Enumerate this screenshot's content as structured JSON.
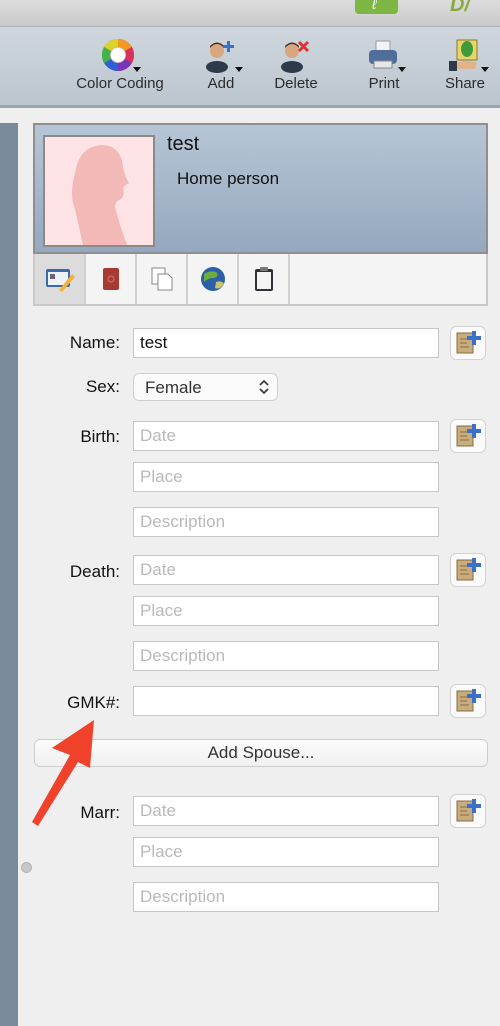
{
  "toolbar": {
    "items": [
      {
        "label": "Color Coding",
        "icon": "color-wheel-icon",
        "has_dropdown": true
      },
      {
        "label": "Add",
        "icon": "add-person-icon",
        "has_dropdown": true
      },
      {
        "label": "Delete",
        "icon": "delete-person-icon",
        "has_dropdown": false
      },
      {
        "label": "Print",
        "icon": "printer-icon",
        "has_dropdown": true
      },
      {
        "label": "Share",
        "icon": "share-tree-icon",
        "has_dropdown": true
      }
    ]
  },
  "person_card": {
    "name": "test",
    "subtitle": "Home person",
    "photo_placeholder": "female-silhouette-icon"
  },
  "tabs": [
    {
      "icon": "edit-person-icon",
      "active": true
    },
    {
      "icon": "book-icon",
      "active": false
    },
    {
      "icon": "documents-icon",
      "active": false
    },
    {
      "icon": "globe-icon",
      "active": false
    },
    {
      "icon": "clipboard-icon",
      "active": false
    }
  ],
  "form": {
    "name": {
      "label": "Name:",
      "value": "test"
    },
    "sex": {
      "label": "Sex:",
      "value": "Female"
    },
    "birth": {
      "label": "Birth:",
      "date_placeholder": "Date",
      "place_placeholder": "Place",
      "description_placeholder": "Description"
    },
    "death": {
      "label": "Death:",
      "date_placeholder": "Date",
      "place_placeholder": "Place",
      "description_placeholder": "Description"
    },
    "gmk": {
      "label": "GMK#:",
      "value": ""
    },
    "add_spouse_label": "Add Spouse...",
    "marr": {
      "label": "Marr:",
      "date_placeholder": "Date",
      "place_placeholder": "Place",
      "description_placeholder": "Description"
    }
  },
  "colors": {
    "annotation_arrow": "#f0412a",
    "sidebar": "#7a8a9b",
    "card_top": "#b7c6d6",
    "card_bottom": "#94a8bf"
  }
}
